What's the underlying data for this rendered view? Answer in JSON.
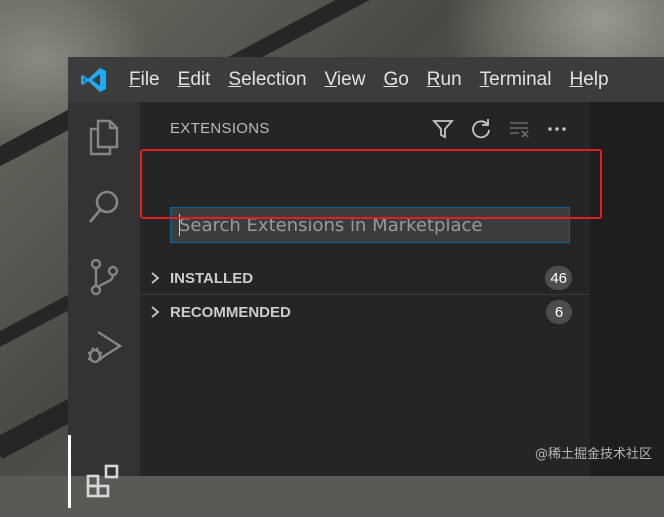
{
  "menubar": {
    "items": [
      {
        "mnemonic": "F",
        "rest": "ile"
      },
      {
        "mnemonic": "E",
        "rest": "dit"
      },
      {
        "mnemonic": "S",
        "rest": "election"
      },
      {
        "mnemonic": "V",
        "rest": "iew"
      },
      {
        "mnemonic": "G",
        "rest": "o"
      },
      {
        "mnemonic": "R",
        "rest": "un"
      },
      {
        "mnemonic": "T",
        "rest": "erminal"
      },
      {
        "mnemonic": "H",
        "rest": "elp"
      }
    ]
  },
  "activitybar": {
    "icons": [
      "explorer-icon",
      "search-icon",
      "source-control-icon",
      "run-debug-icon",
      "extensions-icon"
    ],
    "active": "extensions-icon"
  },
  "sidebar": {
    "title": "EXTENSIONS",
    "actions": [
      "filter-icon",
      "refresh-icon",
      "clear-icon",
      "more-icon"
    ],
    "search": {
      "placeholder": "Search Extensions in Marketplace",
      "value": ""
    },
    "sections": [
      {
        "label": "INSTALLED",
        "count": "46"
      },
      {
        "label": "RECOMMENDED",
        "count": "6"
      }
    ]
  },
  "colors": {
    "accent": "#0e639c",
    "highlight": "#e02020",
    "vscode_blue": "#23a9f2"
  },
  "watermark": "@稀土掘金技术社区"
}
